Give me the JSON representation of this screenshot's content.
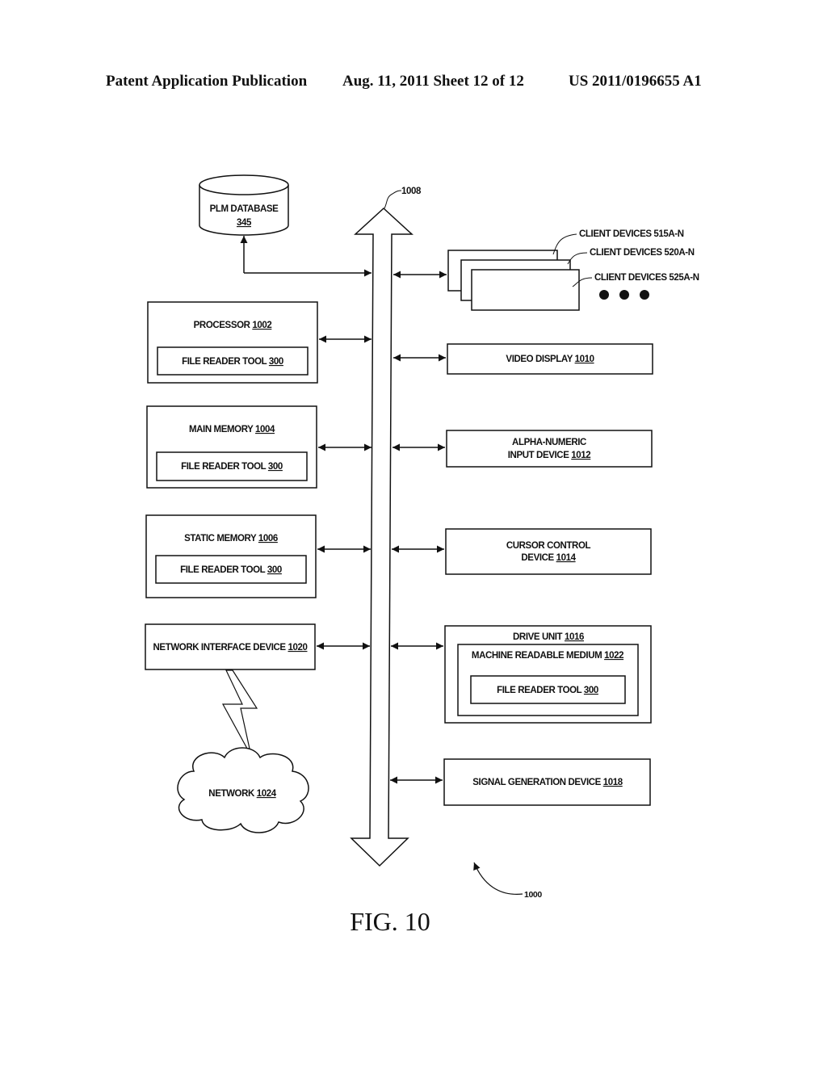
{
  "header": {
    "publication": "Patent Application Publication",
    "date_sheet": "Aug. 11, 2011  Sheet 12 of 12",
    "patent_number": "US 2011/0196655 A1"
  },
  "bus": {
    "ref": "1008"
  },
  "database": {
    "label": "PLM DATABASE",
    "ref": "345"
  },
  "client_devices": [
    {
      "label": "CLIENT DEVICES 515A-N"
    },
    {
      "label": "CLIENT DEVICES 520A-N"
    },
    {
      "label": "CLIENT DEVICES 525A-N"
    }
  ],
  "left_blocks": {
    "processor": {
      "label": "PROCESSOR ",
      "ref": "1002",
      "inner_label": "FILE READER TOOL ",
      "inner_ref": "300"
    },
    "main_memory": {
      "label": "MAIN MEMORY ",
      "ref": "1004",
      "inner_label": "FILE READER TOOL ",
      "inner_ref": "300"
    },
    "static_memory": {
      "label": "STATIC MEMORY ",
      "ref": "1006",
      "inner_label": "FILE READER TOOL ",
      "inner_ref": "300"
    },
    "network_interface": {
      "label": "NETWORK INTERFACE DEVICE ",
      "ref": "1020"
    }
  },
  "network": {
    "label": "NETWORK ",
    "ref": "1024"
  },
  "right_blocks": {
    "video_display": {
      "label": "VIDEO DISPLAY ",
      "ref": "1010"
    },
    "alpha_numeric": {
      "line1": "ALPHA-NUMERIC",
      "label": "INPUT DEVICE ",
      "ref": "1012"
    },
    "cursor_control": {
      "line1": "CURSOR CONTROL",
      "label": "DEVICE ",
      "ref": "1014"
    },
    "drive_unit": {
      "label": "DRIVE UNIT ",
      "ref": "1016",
      "medium_label": "MACHINE READABLE MEDIUM ",
      "medium_ref": "1022",
      "inner_label": "FILE READER TOOL ",
      "inner_ref": "300"
    },
    "signal_generation": {
      "label": "SIGNAL GENERATION DEVICE ",
      "ref": "1018"
    }
  },
  "system_ref": "1000",
  "figure_label": "FIG. 10"
}
